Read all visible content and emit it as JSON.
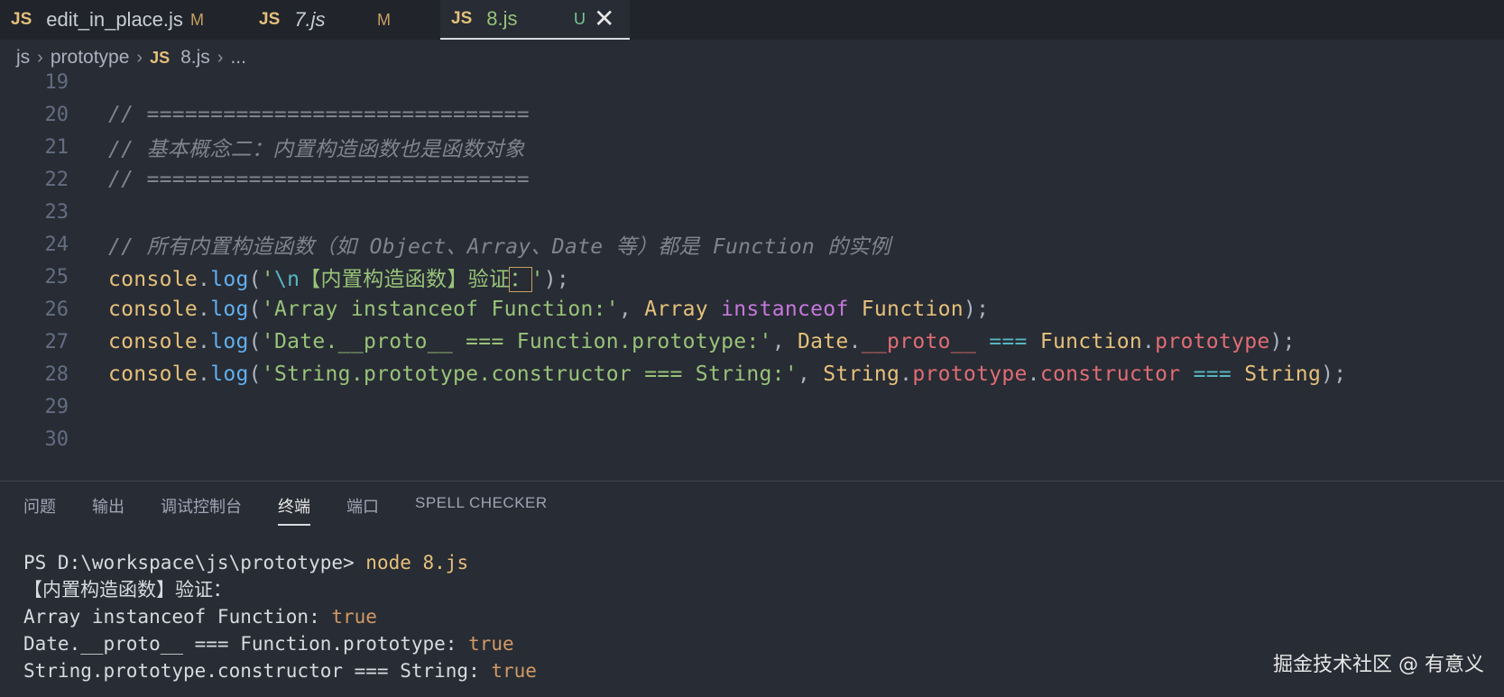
{
  "tabs": [
    {
      "badge": "JS",
      "name": "edit_in_place.js",
      "state": "M"
    },
    {
      "badge": "JS",
      "name": "7.js",
      "state": "M"
    },
    {
      "badge": "JS",
      "name": "8.js",
      "state": "U",
      "close": "✕"
    }
  ],
  "breadcrumb": {
    "items": [
      "js",
      "prototype"
    ],
    "file_badge": "JS",
    "file": "8.js",
    "more": "...",
    "sep": "›"
  },
  "editor": {
    "lines": [
      {
        "n": "19"
      },
      {
        "n": "20",
        "comment": "// =============================="
      },
      {
        "n": "21",
        "comment": "// 基本概念二：内置构造函数也是函数对象"
      },
      {
        "n": "22",
        "comment": "// =============================="
      },
      {
        "n": "23"
      },
      {
        "n": "24",
        "comment": "// 所有内置构造函数（如 Object、Array、Date 等）都是 Function 的实例"
      },
      {
        "n": "25",
        "str_open": "'",
        "esc": "\\n",
        "str_body": "【内置构造函数】验证",
        "str_cursor": "：",
        "str_close": "'"
      },
      {
        "n": "26",
        "str": "'Array instanceof Function:'",
        "a": "Array",
        "kw": "instanceof",
        "b": "Function"
      },
      {
        "n": "27",
        "str": "'Date.__proto__ === Function.prototype:'",
        "a": "Date",
        "p1": "__proto__",
        "op": "===",
        "b": "Function",
        "p2": "prototype"
      },
      {
        "n": "28",
        "str": "'String.prototype.constructor === String:'",
        "a": "String",
        "p1": "prototype",
        "p2": "constructor",
        "op": "===",
        "b": "String"
      },
      {
        "n": "29"
      },
      {
        "n": "30"
      }
    ],
    "console": "console",
    "log": "log"
  },
  "panel": {
    "tabs": [
      "问题",
      "输出",
      "调试控制台",
      "终端",
      "端口",
      "SPELL CHECKER"
    ],
    "active_tab": "终端"
  },
  "terminal": {
    "prompt": "PS D:\\workspace\\js\\prototype> ",
    "command": "node 8.js",
    "lines": [
      {
        "text": "【内置构造函数】验证："
      },
      {
        "text": "Array instanceof Function: ",
        "value": "true"
      },
      {
        "text": "Date.__proto__ === Function.prototype: ",
        "value": "true"
      },
      {
        "text": "String.prototype.constructor === String: ",
        "value": "true"
      }
    ]
  },
  "watermark": "掘金技术社区 @ 有意义"
}
